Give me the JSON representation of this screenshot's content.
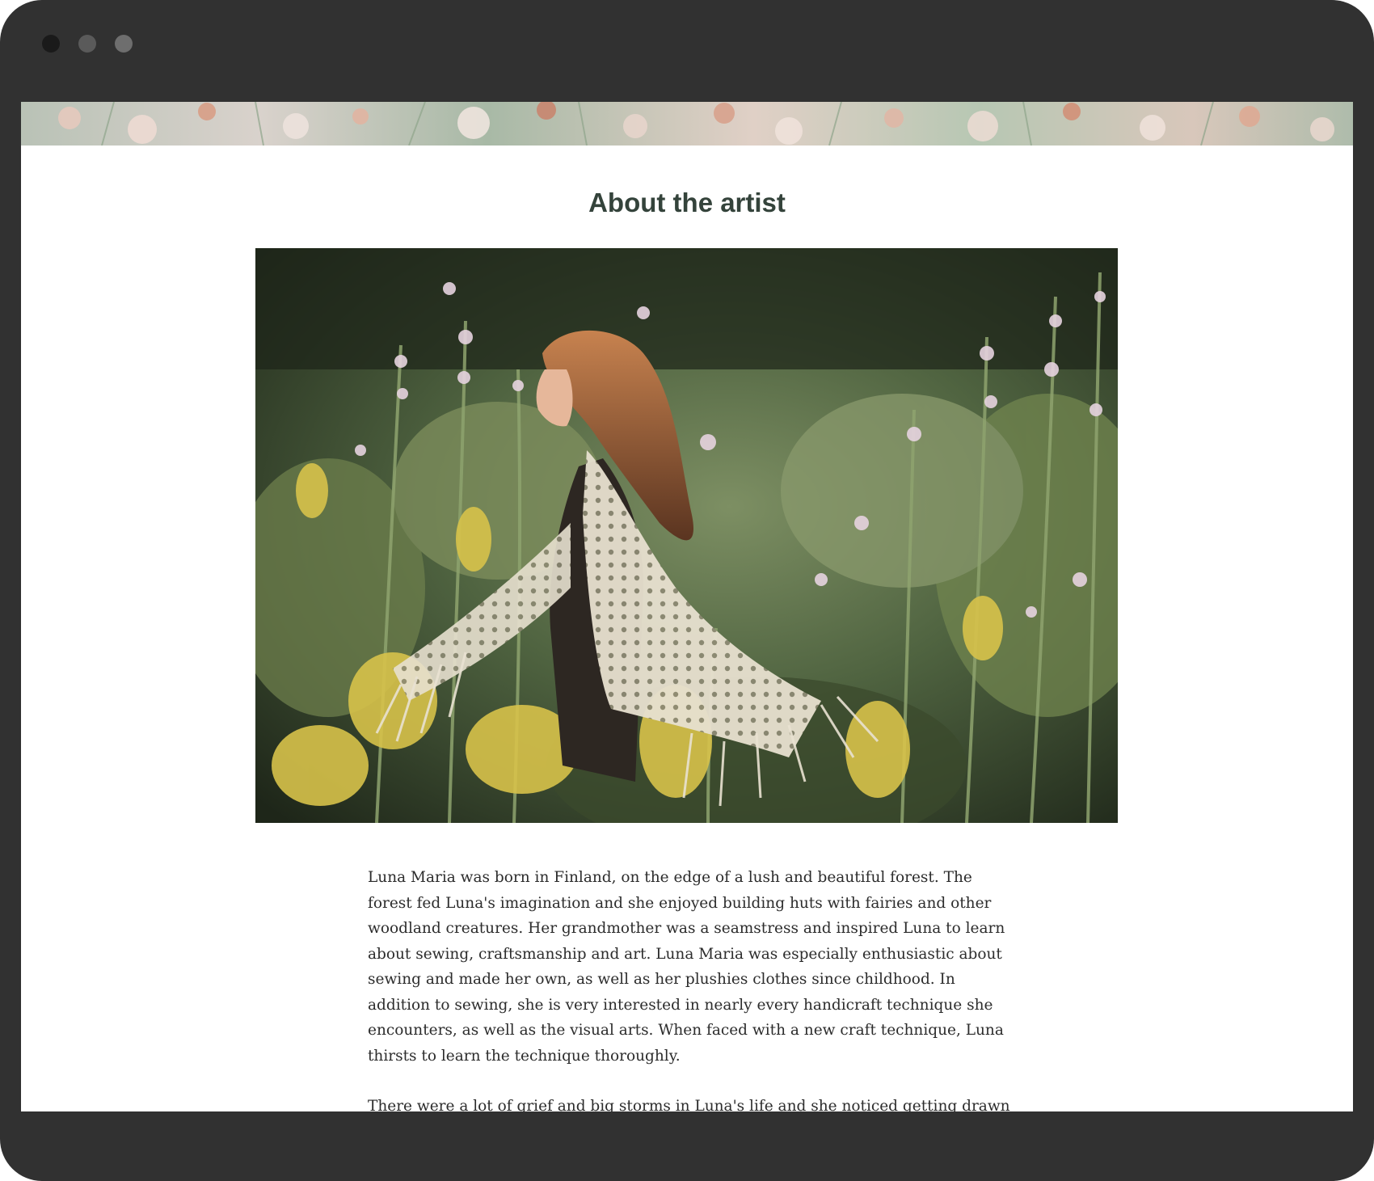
{
  "window": {
    "traffic_lights": [
      "#1a1a1a",
      "#5a5a5a",
      "#6e6e6e"
    ]
  },
  "page": {
    "heading": "About the artist",
    "paragraphs": [
      "Luna Maria was born in Finland, on the edge of a lush and beautiful forest. The forest fed Luna's imagination and she enjoyed building huts with fairies and other woodland creatures. Her grandmother was a seamstress and inspired Luna to learn about sewing, craftsmanship and art. Luna Maria was especially enthusiastic about sewing and made her own, as well as her plushies clothes since childhood. In addition to sewing, she is very interested in nearly every handicraft technique she encounters, as well as the visual arts. When faced with a new craft technique, Luna thirsts to learn the technique thoroughly.",
      "There were a lot of grief and big storms in Luna's life and she noticed getting drawn back to her crafts for comfort. They gave her strength and peace to the anxious mind. Since then,"
    ],
    "colors": {
      "heading": "#34433b",
      "text": "#2c2c2c",
      "frame": "#313131"
    }
  }
}
